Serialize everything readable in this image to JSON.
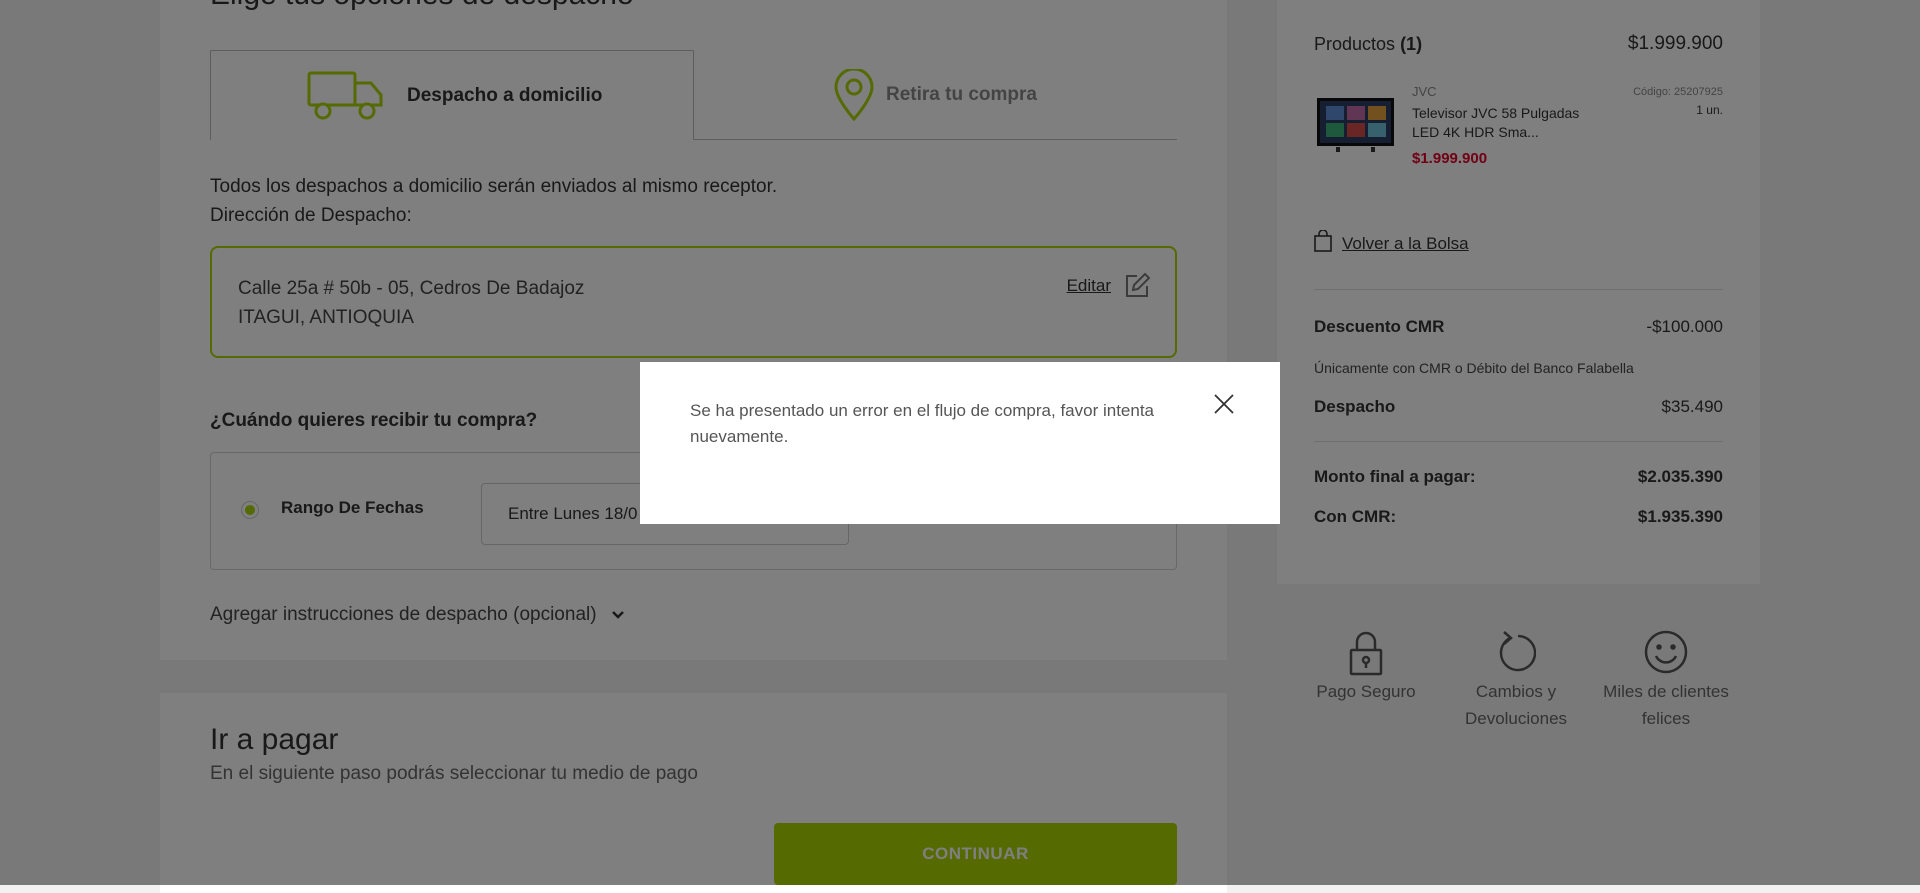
{
  "delivery": {
    "section_title": "Elige tus opciones de despacho",
    "tabs": [
      {
        "label": "Despacho a domicilio",
        "icon": "truck-icon",
        "selected": true
      },
      {
        "label": "Retira tu compra",
        "icon": "location-pin-icon",
        "selected": false
      }
    ],
    "info_line": "Todos los despachos a domicilio serán enviados al mismo receptor.",
    "address_label": "Dirección de Despacho:",
    "address_line1": "Calle 25a # 50b - 05, Cedros De Badajoz",
    "address_line2": "ITAGUI, ANTIOQUIA",
    "edit_label": "Editar",
    "question": "¿Cuándo quieres recibir tu compra?",
    "date_option_label": "Rango De Fechas",
    "date_select_value": "Entre Lunes 18/0",
    "instructions_label": "Agregar instrucciones de despacho (opcional)"
  },
  "payment": {
    "title": "Ir a pagar",
    "subtitle": "En el siguiente paso podrás seleccionar tu medio de pago",
    "continue_label": "CONTINUAR"
  },
  "summary": {
    "products_label": "Productos",
    "products_count": "(1)",
    "products_total": "$1.999.900",
    "item": {
      "brand": "JVC",
      "name": "Televisor JVC 58 Pulgadas LED 4K HDR Sma...",
      "price": "$1.999.900",
      "code": "Código: 25207925",
      "qty": "1 un."
    },
    "back_to_bag": "Volver a la Bolsa",
    "discount_label": "Descuento CMR",
    "discount_value": "-$100.000",
    "discount_note": "Únicamente con CMR o Débito del Banco Falabella",
    "shipping_label": "Despacho",
    "shipping_value": "$35.490",
    "final_label": "Monto final a pagar:",
    "final_value": "$2.035.390",
    "cmr_label": "Con CMR:",
    "cmr_value": "$1.935.390"
  },
  "trust": [
    {
      "icon": "padlock-icon",
      "label": "Pago Seguro"
    },
    {
      "icon": "refresh-icon",
      "label": "Cambios y Devoluciones"
    },
    {
      "icon": "smiley-icon",
      "label": "Miles de clientes felices"
    }
  ],
  "modal": {
    "message": "Se ha presentado un error en el flujo de compra, favor intenta nuevamente."
  },
  "colors": {
    "accent": "#aad500",
    "price_red": "#e4002b",
    "overlay": "rgba(0,0,0,0.5)"
  }
}
